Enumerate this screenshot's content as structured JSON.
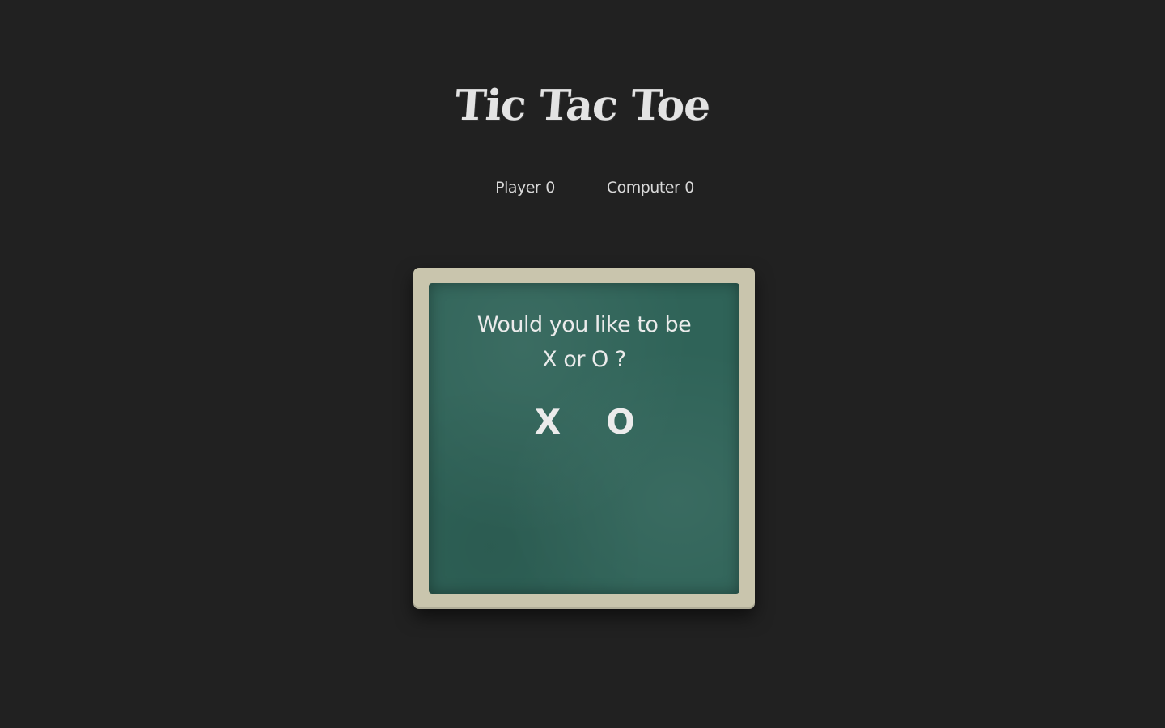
{
  "title": "Tic Tac Toe",
  "scores": {
    "player_label": "Player",
    "player_value": "0",
    "computer_label": "Computer",
    "computer_value": "0"
  },
  "board": {
    "question_line1": "Would you like to be",
    "question_line2": "X or O ?",
    "choice_x": "X",
    "choice_o": "O"
  },
  "colors": {
    "background": "#212121",
    "frame": "#c9c5ad",
    "chalkboard": "#2f6358",
    "chalk": "#ebebeb"
  }
}
